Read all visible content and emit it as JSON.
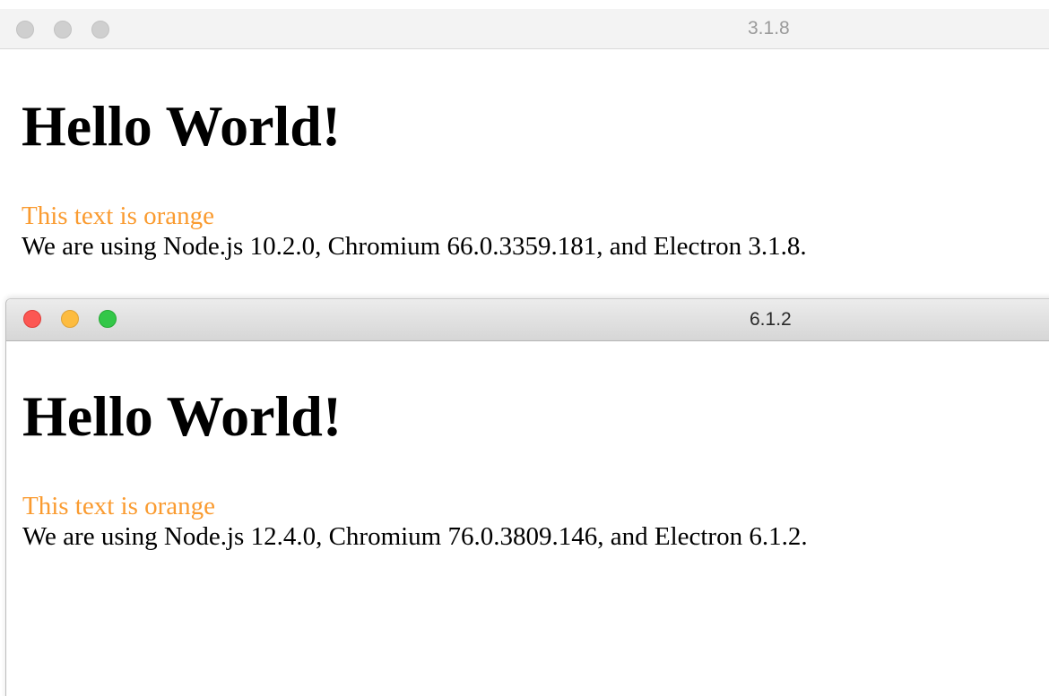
{
  "windows": [
    {
      "title": "3.1.8",
      "state": "inactive",
      "heading": "Hello World!",
      "orange_text": "This text is orange",
      "versions_text": "We are using Node.js 10.2.0, Chromium 66.0.3359.181, and Electron 3.1.8."
    },
    {
      "title": "6.1.2",
      "state": "active",
      "heading": "Hello World!",
      "orange_text": "This text is orange",
      "versions_text": "We are using Node.js 12.4.0, Chromium 76.0.3809.146, and Electron 6.1.2."
    }
  ],
  "colors": {
    "orange_text": "#fa9b30",
    "close": "#fc5753",
    "minimize": "#fdbc40",
    "zoom": "#33c748",
    "inactive_light": "#cfcfcf"
  },
  "icons": [
    "close-icon",
    "minimize-icon",
    "zoom-icon"
  ]
}
